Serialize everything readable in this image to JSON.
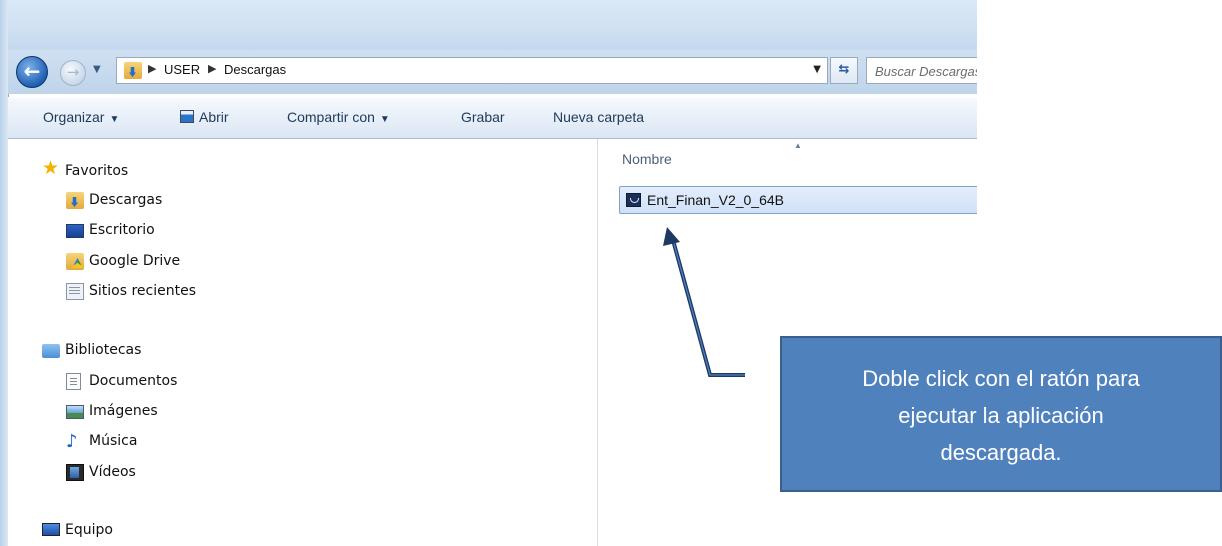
{
  "address": {
    "segments": [
      "USER",
      "Descargas"
    ],
    "search_placeholder": "Buscar Descargas"
  },
  "toolbar": {
    "organizar": "Organizar",
    "abrir": "Abrir",
    "compartir": "Compartir con",
    "grabar": "Grabar",
    "nueva_carpeta": "Nueva carpeta"
  },
  "nav": {
    "favoritos": "Favoritos",
    "descargas": "Descargas",
    "escritorio": "Escritorio",
    "google_drive": "Google Drive",
    "sitios_recientes": "Sitios recientes",
    "bibliotecas": "Bibliotecas",
    "documentos": "Documentos",
    "imagenes": "Imágenes",
    "musica": "Música",
    "videos": "Vídeos",
    "equipo": "Equipo"
  },
  "content": {
    "column_header": "Nombre",
    "files": [
      {
        "name": "Ent_Finan_V2_0_64B",
        "selected": true
      }
    ]
  },
  "annotation": {
    "line1": "Doble click con el ratón para",
    "line2": "ejecutar la aplicación",
    "line3": "descargada.",
    "fill_color": "#4f81bd",
    "border_color": "#3a5f8c",
    "arrow_color": "#1f3864"
  }
}
